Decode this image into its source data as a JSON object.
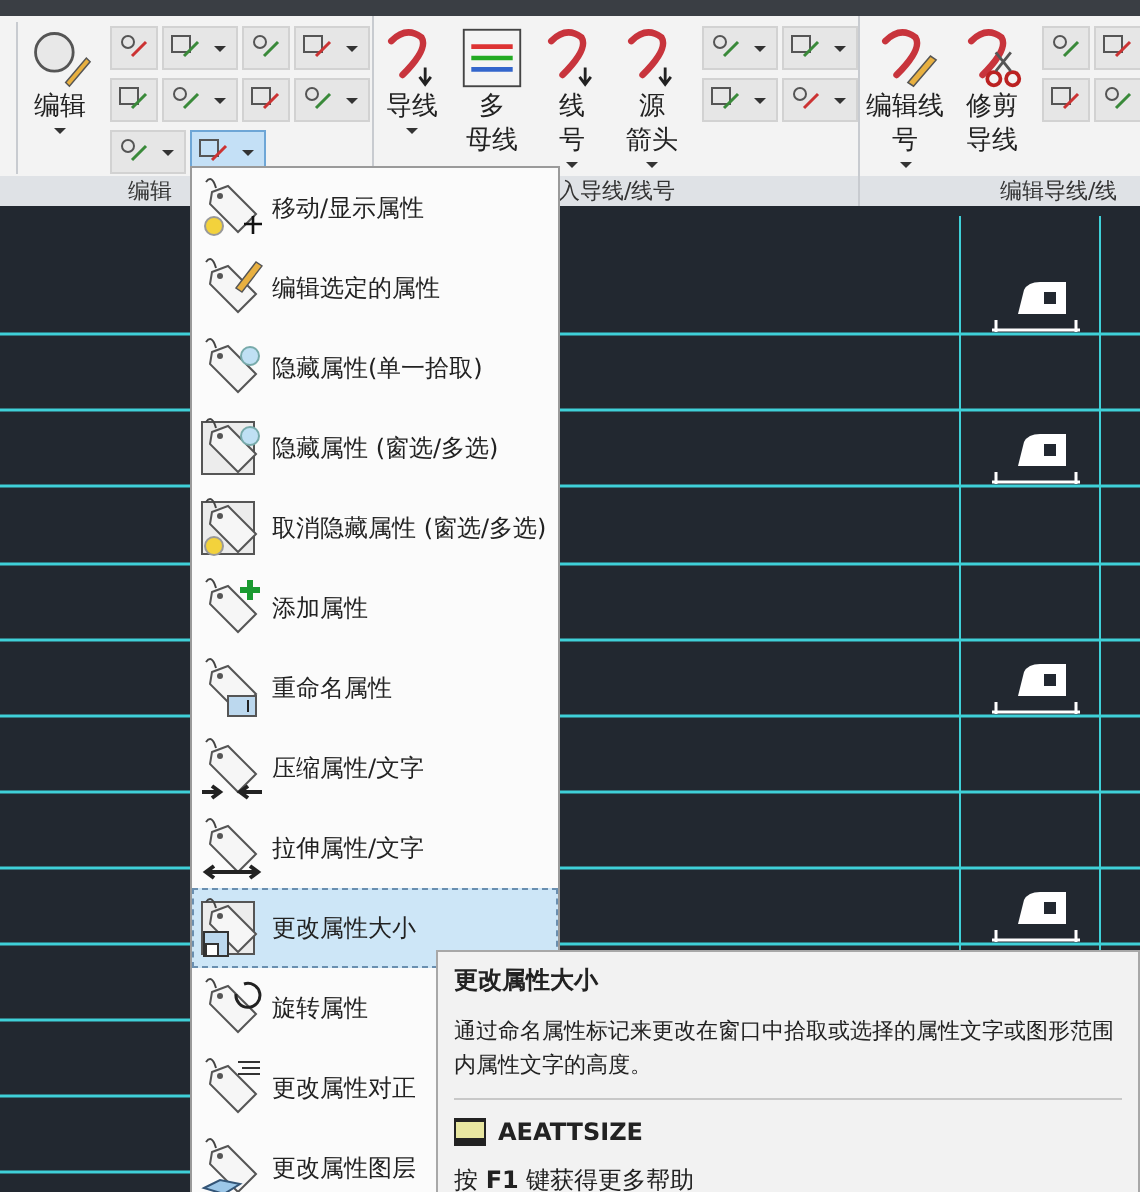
{
  "panels": [
    {
      "label": "编辑",
      "big_buttons": [
        {
          "lines": [
            "编辑"
          ],
          "dropdown": true
        }
      ],
      "tool_rows": [
        [
          {
            "dropdown": false,
            "open": false
          },
          {
            "dropdown": true,
            "open": false
          },
          {
            "dropdown": false,
            "open": false
          },
          {
            "dropdown": true,
            "open": false
          }
        ],
        [
          {
            "dropdown": false,
            "open": false
          },
          {
            "dropdown": true,
            "open": false
          },
          {
            "dropdown": false,
            "open": false
          },
          {
            "dropdown": true,
            "open": false
          }
        ],
        [
          {
            "dropdown": true,
            "open": false
          },
          {
            "dropdown": true,
            "open": true
          }
        ]
      ]
    },
    {
      "label": "入导线/线号",
      "big_buttons": [
        {
          "lines": [
            "导线"
          ],
          "dropdown": true
        },
        {
          "lines": [
            "多",
            "母线"
          ],
          "dropdown": false
        },
        {
          "lines": [
            "线",
            "号"
          ],
          "dropdown": true
        },
        {
          "lines": [
            "源",
            "箭头"
          ],
          "dropdown": true
        }
      ],
      "tool_rows": [
        [
          {
            "dropdown": true,
            "open": false
          },
          {
            "dropdown": true,
            "open": false
          }
        ],
        [
          {
            "dropdown": true,
            "open": false
          },
          {
            "dropdown": true,
            "open": false
          }
        ]
      ]
    },
    {
      "label": "编辑导线/线",
      "big_buttons": [
        {
          "lines": [
            "编辑线",
            "号"
          ],
          "dropdown": true
        },
        {
          "lines": [
            "修剪",
            "导线"
          ],
          "dropdown": false
        }
      ],
      "tool_rows": [
        [
          {
            "dropdown": false,
            "open": false
          },
          {
            "dropdown": false,
            "open": false
          }
        ],
        [
          {
            "dropdown": false,
            "open": false
          },
          {
            "dropdown": false,
            "open": false
          }
        ]
      ]
    }
  ],
  "menu": {
    "items": [
      {
        "label": "移动/显示属性",
        "selected": false
      },
      {
        "label": "编辑选定的属性",
        "selected": false
      },
      {
        "label": "隐藏属性(单一拾取)",
        "selected": false
      },
      {
        "label": "隐藏属性 (窗选/多选)",
        "selected": false
      },
      {
        "label": "取消隐藏属性 (窗选/多选)",
        "selected": false
      },
      {
        "label": "添加属性",
        "selected": false
      },
      {
        "label": "重命名属性",
        "selected": false
      },
      {
        "label": "压缩属性/文字",
        "selected": false
      },
      {
        "label": "拉伸属性/文字",
        "selected": false
      },
      {
        "label": "更改属性大小",
        "selected": true
      },
      {
        "label": "旋转属性",
        "selected": false
      },
      {
        "label": "更改属性对正",
        "selected": false
      },
      {
        "label": "更改属性图层",
        "selected": false
      }
    ]
  },
  "tooltip": {
    "title": "更改属性大小",
    "description": "通过命名属性标记来更改在窗口中拾取或选择的属性文字或图形范围内属性文字的高度。",
    "command": "AEATTSIZE",
    "help": "按 **F1** 键获得更多帮助"
  }
}
